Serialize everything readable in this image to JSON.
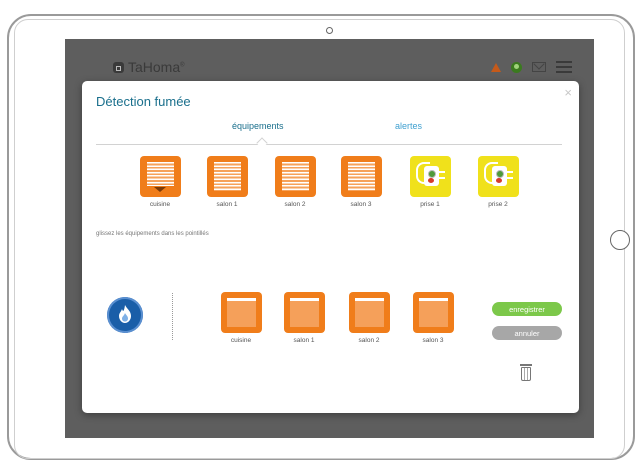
{
  "app": {
    "brand": "TaHoma",
    "brand_mark": "®"
  },
  "header": {
    "icons": [
      "warning-icon",
      "user-icon",
      "mail-icon",
      "menu-icon"
    ]
  },
  "modal": {
    "title": "Détection fumée",
    "close": "×",
    "tabs": [
      {
        "label": "équipements",
        "active": true
      },
      {
        "label": "alertes",
        "active": false
      }
    ],
    "devices": [
      {
        "label": "cuisine",
        "type": "shutter"
      },
      {
        "label": "salon 1",
        "type": "shutter"
      },
      {
        "label": "salon 2",
        "type": "shutter"
      },
      {
        "label": "salon 3",
        "type": "shutter"
      },
      {
        "label": "prise 1",
        "type": "plug"
      },
      {
        "label": "prise 2",
        "type": "plug"
      }
    ],
    "hint": "glissez les équipements dans les pointillés",
    "targets": [
      {
        "label": "cuisine"
      },
      {
        "label": "salon 1"
      },
      {
        "label": "salon 2"
      },
      {
        "label": "salon 3"
      }
    ],
    "buttons": {
      "save": "enregistrer",
      "cancel": "annuler"
    }
  },
  "colors": {
    "title": "#1a6f8c",
    "shutter": "#f07d1a",
    "plug": "#f0e11b",
    "save": "#7cc84a",
    "cancel": "#a7a7a7",
    "smoke_badge": "#1a5ea8"
  }
}
